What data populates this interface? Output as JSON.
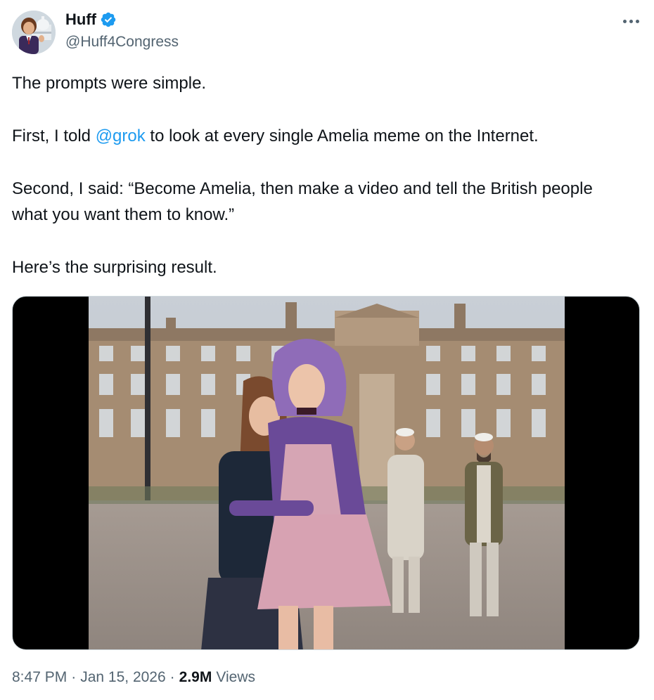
{
  "author": {
    "display_name": "Huff",
    "handle": "@Huff4Congress",
    "verified": true,
    "avatar_icon": "profile-avatar"
  },
  "tweet": {
    "line1": "The prompts were simple.",
    "line2_before": "First, I told ",
    "line2_mention": "@grok",
    "line2_after": " to look at every single Amelia meme on the Internet.",
    "line3": "Second, I said: “Become Amelia, then make a video and tell the British people what you want them to know.”",
    "line4": "Here’s the surprising result."
  },
  "media": {
    "type": "video-thumbnail",
    "icon": "video-frame"
  },
  "meta": {
    "time": "8:47 PM",
    "separator1": "·",
    "date": "Jan 15, 2026",
    "separator2": "·",
    "views_count": "2.9M",
    "views_label": "Views"
  },
  "colors": {
    "accent": "#1d9bf0",
    "secondary_text": "#536471",
    "primary_text": "#0f1419"
  },
  "icons": {
    "more": "more-horizontal-icon",
    "verified": "verified-badge-icon"
  }
}
